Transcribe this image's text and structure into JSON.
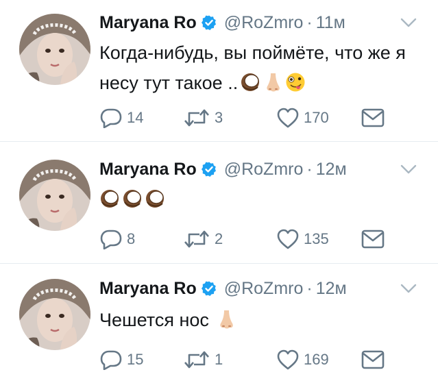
{
  "user": {
    "name": "Maryana Ro",
    "handle": "@RoZmro",
    "separator": "·"
  },
  "tweets": [
    {
      "time": "11м",
      "text": "Когда-нибудь, вы поймёте, что же я несу тут такое ..",
      "emojis": [
        "coconut-emoji",
        "nose-emoji",
        "zany-face-emoji"
      ],
      "replies": "14",
      "retweets": "3",
      "likes": "170"
    },
    {
      "time": "12м",
      "text": "",
      "emojis": [
        "coconut-emoji",
        "coconut-emoji",
        "coconut-emoji"
      ],
      "replies": "8",
      "retweets": "2",
      "likes": "135"
    },
    {
      "time": "12м",
      "text": "Чешется нос ",
      "emojis": [
        "nose-emoji"
      ],
      "replies": "15",
      "retweets": "1",
      "likes": "169"
    }
  ],
  "icons": {
    "reply": "reply-icon",
    "retweet": "retweet-icon",
    "like": "like-icon",
    "dm": "message-icon",
    "verified": "verified-badge-icon",
    "more": "chevron-down-icon"
  },
  "colors": {
    "accent": "#1da1f2",
    "muted": "#657786",
    "text": "#14171a",
    "border": "#e6ecf0"
  }
}
